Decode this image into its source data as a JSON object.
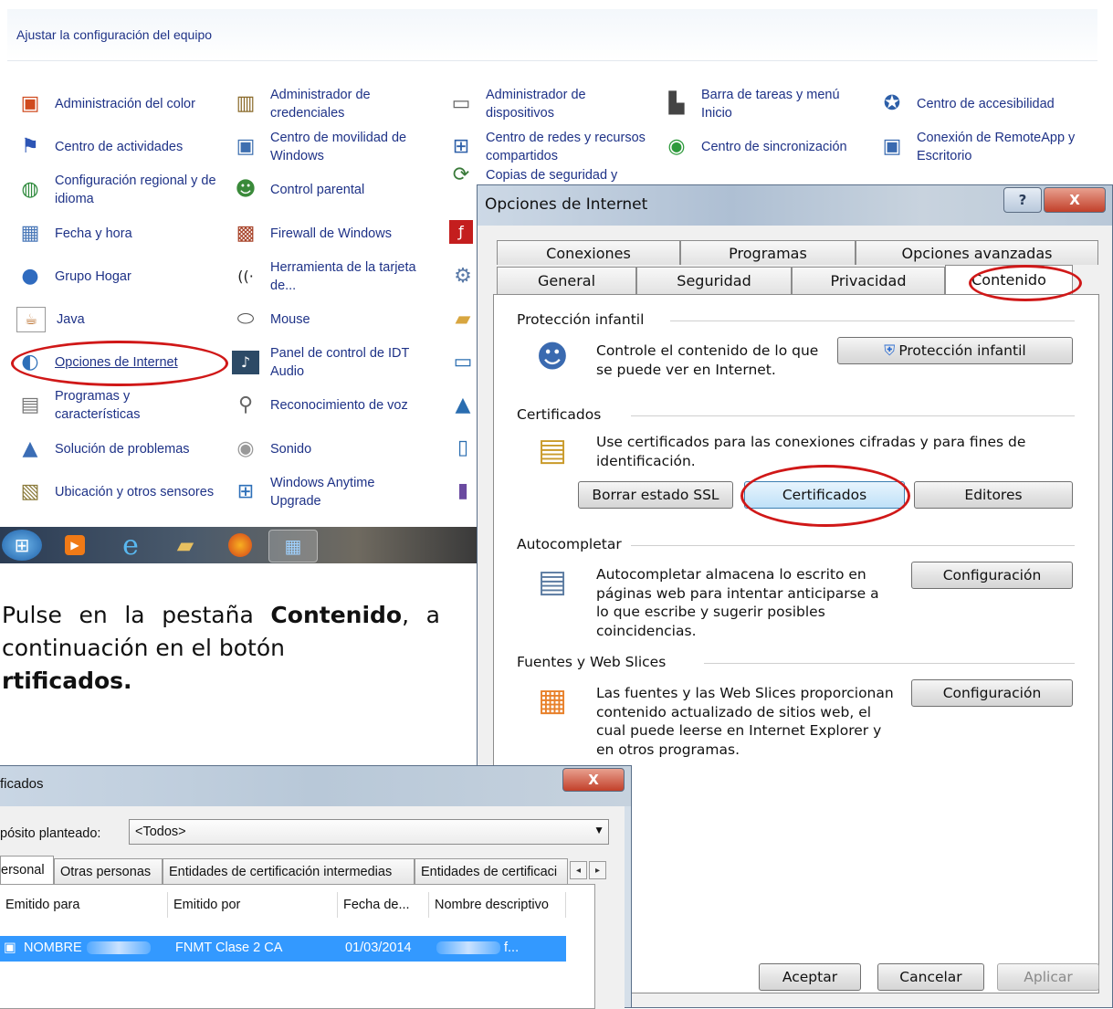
{
  "control_panel": {
    "title": "Ajustar la configuración del equipo",
    "items": [
      {
        "label": "Administración del color",
        "icon": "color-management-icon"
      },
      {
        "label": "Administrador de credenciales",
        "icon": "credential-manager-icon"
      },
      {
        "label": "Administrador de dispositivos",
        "icon": "device-manager-icon"
      },
      {
        "label": "Barra de tareas y menú Inicio",
        "icon": "taskbar-icon"
      },
      {
        "label": "Centro de accesibilidad",
        "icon": "accessibility-icon"
      },
      {
        "label": "Centro de actividades",
        "icon": "flag-icon"
      },
      {
        "label": "Centro de movilidad de Windows",
        "icon": "mobility-icon"
      },
      {
        "label": "Centro de redes y recursos compartidos",
        "icon": "network-icon"
      },
      {
        "label": "Centro de sincronización",
        "icon": "sync-icon"
      },
      {
        "label": "Conexión de RemoteApp y Escritorio",
        "icon": "remote-desktop-icon"
      },
      {
        "label": "Configuración regional y de idioma",
        "icon": "globe-icon"
      },
      {
        "label": "Control parental",
        "icon": "parental-control-icon"
      },
      {
        "label": "Copias de seguridad y",
        "icon": "backup-icon"
      },
      {
        "label": "Fecha y hora",
        "icon": "calendar-icon"
      },
      {
        "label": "Firewall de Windows",
        "icon": "firewall-icon"
      },
      {
        "label": "Grupo Hogar",
        "icon": "homegroup-icon"
      },
      {
        "label": "Herramienta de la tarjeta de...",
        "icon": "wireless-card-icon"
      },
      {
        "label": "Java",
        "icon": "java-icon"
      },
      {
        "label": "Mouse",
        "icon": "mouse-icon"
      },
      {
        "label": "Opciones de Internet",
        "icon": "internet-options-icon"
      },
      {
        "label": "Panel de control de IDT Audio",
        "icon": "audio-panel-icon"
      },
      {
        "label": "Programas y características",
        "icon": "programs-icon"
      },
      {
        "label": "Reconocimiento de voz",
        "icon": "microphone-icon"
      },
      {
        "label": "Solución de problemas",
        "icon": "troubleshoot-icon"
      },
      {
        "label": "Sonido",
        "icon": "speaker-icon"
      },
      {
        "label": "Ubicación y otros sensores",
        "icon": "location-sensor-icon"
      },
      {
        "label": "Windows Anytime Upgrade",
        "icon": "windows-upgrade-icon"
      }
    ]
  },
  "taskbar": {
    "buttons": [
      "start-orb-icon",
      "media-player-icon",
      "internet-explorer-icon",
      "file-explorer-icon",
      "firefox-icon",
      "control-panel-icon"
    ]
  },
  "instructions": {
    "part1": "Pulse en la pestaña ",
    "bold1": "Contenido",
    "part2": ", a continuación en el botón ",
    "bold2": "rtificados."
  },
  "internet_options": {
    "title": "Opciones de Internet",
    "help_label": "?",
    "close_label": "X",
    "tabs_row1": [
      "Conexiones",
      "Programas",
      "Opciones avanzadas"
    ],
    "tabs_row2": [
      "General",
      "Seguridad",
      "Privacidad",
      "Contenido"
    ],
    "active_tab": "Contenido",
    "sections": {
      "parental": {
        "title": "Protección infantil",
        "text": "Controle el contenido de lo que se puede ver en Internet.",
        "button": "Protección infantil"
      },
      "certificates": {
        "title": "Certificados",
        "text": "Use certificados para las conexiones cifradas y para fines de identificación.",
        "buttons": [
          "Borrar estado SSL",
          "Certificados",
          "Editores"
        ]
      },
      "autocomplete": {
        "title": "Autocompletar",
        "text": "Autocompletar almacena lo escrito en páginas web para intentar anticiparse a lo que escribe y sugerir posibles coincidencias.",
        "button": "Configuración"
      },
      "feeds": {
        "title": "Fuentes y Web Slices",
        "text": "Las fuentes y las Web Slices proporcionan contenido actualizado de sitios web, el cual puede leerse en Internet Explorer y en otros programas.",
        "button": "Configuración"
      }
    },
    "footer_buttons": [
      "Aceptar",
      "Cancelar",
      "Aplicar"
    ]
  },
  "certificates_dialog": {
    "title": "ficados",
    "close_label": "X",
    "purpose_label": "pósito planteado:",
    "purpose_value": "<Todos>",
    "tabs": [
      "ersonal",
      "Otras personas",
      "Entidades de certificación intermedias",
      "Entidades de certificaci"
    ],
    "columns": [
      "Emitido para",
      "Emitido por",
      "Fecha de...",
      "Nombre descriptivo"
    ],
    "rows": [
      {
        "issued_to": "NOMBRE",
        "issued_by": "FNMT Clase 2 CA",
        "date": "01/03/2014",
        "friendly_name": "f..."
      }
    ]
  },
  "annotation_color": "#d01818"
}
